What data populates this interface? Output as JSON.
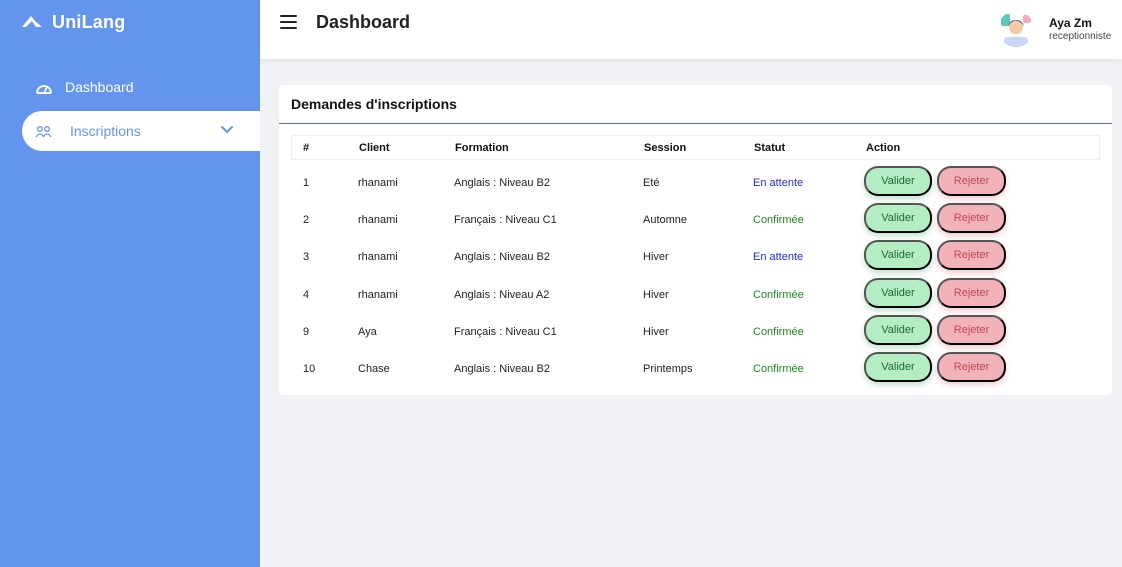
{
  "brand": {
    "name": "UniLang"
  },
  "sidebar": {
    "items": [
      {
        "label": "Dashboard",
        "icon": "dashboard-icon"
      },
      {
        "label": "Inscriptions",
        "icon": "users-icon",
        "active": true
      }
    ]
  },
  "header": {
    "title": "Dashboard",
    "user": {
      "name": "Aya Zm",
      "role": "receptionniste"
    }
  },
  "card": {
    "title": "Demandes d'inscriptions",
    "columns": [
      "#",
      "Client",
      "Formation",
      "Session",
      "Statut",
      "Action"
    ],
    "rows": [
      {
        "id": "1",
        "client": "rhanami",
        "formation": "Anglais : Niveau B2",
        "session": "Eté",
        "statut": "En attente"
      },
      {
        "id": "2",
        "client": "rhanami",
        "formation": "Français : Niveau C1",
        "session": "Automne",
        "statut": "Confirmée"
      },
      {
        "id": "3",
        "client": "rhanami",
        "formation": "Anglais : Niveau B2",
        "session": "Hiver",
        "statut": "En attente"
      },
      {
        "id": "4",
        "client": "rhanami",
        "formation": "Anglais : Niveau A2",
        "session": "Hiver",
        "statut": "Confirmée"
      },
      {
        "id": "9",
        "client": "Aya",
        "formation": "Français : Niveau C1",
        "session": "Hiver",
        "statut": "Confirmée"
      },
      {
        "id": "10",
        "client": "Chase",
        "formation": "Anglais : Niveau B2",
        "session": "Printemps",
        "statut": "Confirmée"
      }
    ],
    "actions": {
      "validate": "Valider",
      "reject": "Rejeter"
    }
  },
  "colors": {
    "sidebar": "#6495ed",
    "status_pending": "#1f2fd1",
    "status_confirmed": "#1f8a1f",
    "validate_button": "#b4ecc4",
    "reject_button": "#f2b3b8"
  }
}
